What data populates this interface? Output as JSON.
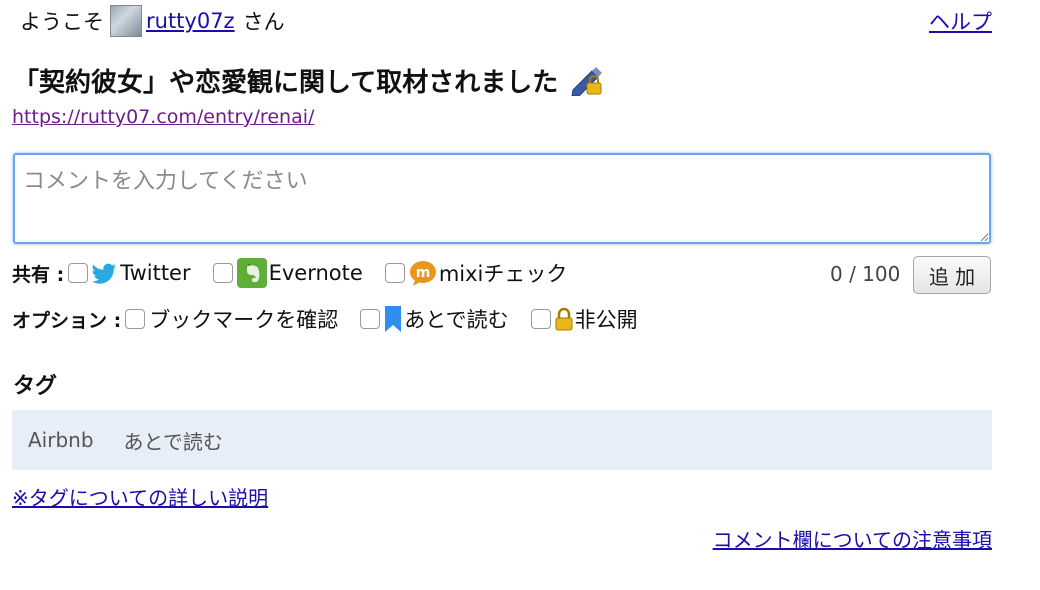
{
  "header": {
    "greeting_prefix": "ようこそ",
    "username": "rutty07z",
    "greeting_suffix": "さん",
    "help_link": "ヘルプ"
  },
  "entry": {
    "title": "「契約彼女」や恋愛観に関して取材されました",
    "url": "https://rutty07.com/entry/renai/"
  },
  "comment": {
    "placeholder": "コメントを入力してください",
    "value": "",
    "counter": "0 / 100",
    "add_button": "追 加"
  },
  "share": {
    "label": "共有 :",
    "options": [
      {
        "label": "Twitter",
        "icon": "twitter-icon",
        "checked": false
      },
      {
        "label": "Evernote",
        "icon": "evernote-icon",
        "checked": false
      },
      {
        "label": "mixiチェック",
        "icon": "mixi-icon",
        "checked": false
      }
    ]
  },
  "options": {
    "label": "オプション :",
    "items": [
      {
        "label": "ブックマークを確認",
        "checked": false
      },
      {
        "label": "あとで読む",
        "icon": "bookmark-icon",
        "checked": false
      },
      {
        "label": "非公開",
        "icon": "lock-icon",
        "checked": false
      }
    ]
  },
  "tags": {
    "heading": "タグ",
    "items": [
      "Airbnb",
      "あとで読む"
    ],
    "help_link": "※タグについての詳しい説明"
  },
  "footer": {
    "comment_note_link": "コメント欄についての注意事項"
  },
  "colors": {
    "link": "#1a0dab",
    "visited": "#6b1e8c",
    "tag_bg": "#e8eef8",
    "focus_border": "#6aa5e8"
  }
}
